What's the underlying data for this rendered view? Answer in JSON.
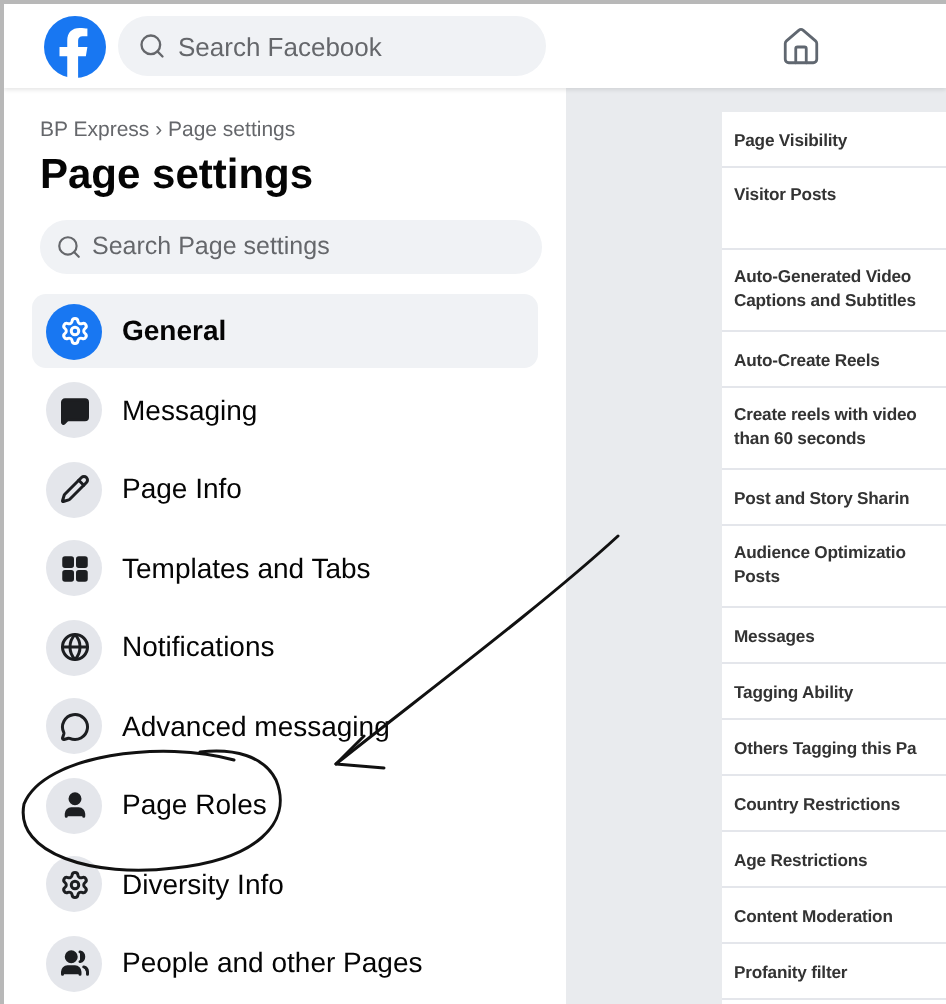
{
  "topbar": {
    "search": {
      "placeholder": "Search Facebook"
    }
  },
  "sidebar": {
    "breadcrumb": "BP Express › Page settings",
    "title": "Page settings",
    "search": {
      "placeholder": "Search Page settings"
    },
    "items": [
      {
        "label": "General",
        "selected": true
      },
      {
        "label": "Messaging",
        "selected": false
      },
      {
        "label": "Page Info",
        "selected": false
      },
      {
        "label": "Templates and Tabs",
        "selected": false
      },
      {
        "label": "Notifications",
        "selected": false
      },
      {
        "label": "Advanced messaging",
        "selected": false
      },
      {
        "label": "Page Roles",
        "selected": false
      },
      {
        "label": "Diversity Info",
        "selected": false
      },
      {
        "label": "People and other Pages",
        "selected": false
      }
    ]
  },
  "settings": [
    {
      "label": "Page Visibility"
    },
    {
      "label": "Visitor Posts"
    },
    {
      "label": "Auto-Generated Video Captions and Subtitles"
    },
    {
      "label": "Auto-Create Reels"
    },
    {
      "label": "Create reels with video than 60 seconds"
    },
    {
      "label": "Post and Story Sharin"
    },
    {
      "label": "Audience Optimizatio Posts"
    },
    {
      "label": "Messages"
    },
    {
      "label": "Tagging Ability"
    },
    {
      "label": "Others Tagging this Pa"
    },
    {
      "label": "Country Restrictions"
    },
    {
      "label": "Age Restrictions"
    },
    {
      "label": "Content Moderation"
    },
    {
      "label": "Profanity filter"
    }
  ]
}
